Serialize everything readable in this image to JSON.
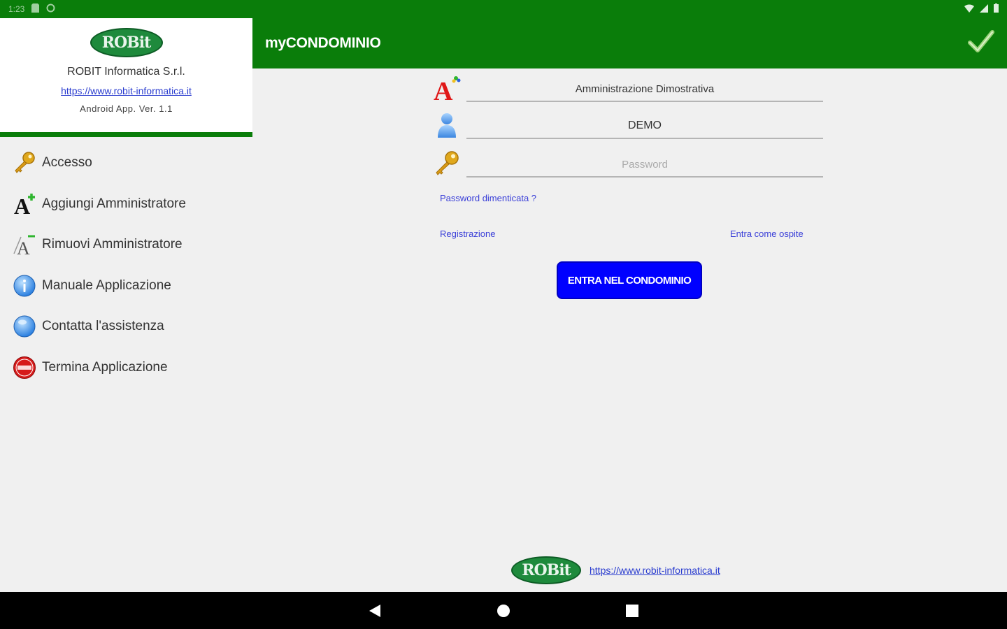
{
  "statusbar": {
    "time": "1:23"
  },
  "appbar": {
    "title": "myCONDOMINIO"
  },
  "drawer": {
    "logo_text": "ROBit",
    "company": "ROBIT Informatica S.r.l.",
    "website": "https://www.robit-informatica.it",
    "version": "Android App. Ver. 1.1",
    "items": [
      {
        "label": "Accesso",
        "icon": "key-icon"
      },
      {
        "label": "Aggiungi Amministratore",
        "icon": "add-admin-icon"
      },
      {
        "label": "Rimuovi Amministratore",
        "icon": "remove-admin-icon"
      },
      {
        "label": "Manuale Applicazione",
        "icon": "info-icon"
      },
      {
        "label": "Contatta l'assistenza",
        "icon": "support-icon"
      },
      {
        "label": "Termina Applicazione",
        "icon": "stop-icon"
      }
    ]
  },
  "form": {
    "admin_value": "Amministrazione Dimostrativa",
    "user_value": "DEMO",
    "password_placeholder": "Password",
    "forgot_password": "Password dimenticata ?",
    "register": "Registrazione",
    "guest": "Entra come ospite",
    "enter_button": "ENTRA NEL CONDOMINIO"
  },
  "footer": {
    "logo_text": "ROBit",
    "website": "https://www.robit-informatica.it"
  },
  "colors": {
    "primary_green": "#0a7d0a",
    "button_blue": "#0000ff",
    "link_blue": "#3a3fd8"
  }
}
